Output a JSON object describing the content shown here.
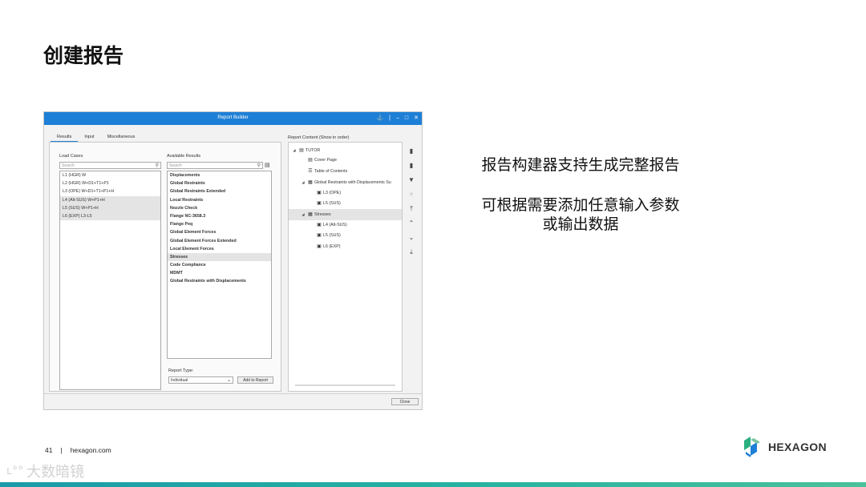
{
  "slide": {
    "title": "创建报告",
    "description_line1": "报告构建器支持生成完整报告",
    "description_line2": "可根据需要添加任意输入参数",
    "description_line3": "或输出数据",
    "page_number": "41",
    "separator": "|",
    "website": "hexagon.com",
    "logo_text": "HEXAGON",
    "watermark": "大数暗镜"
  },
  "window": {
    "title": "Report Builder",
    "controls": [
      "⚓",
      "|",
      "–",
      "□",
      "✕"
    ],
    "tabs": [
      "Results",
      "Input",
      "Miscellaneous"
    ],
    "active_tab": "Results",
    "load_cases_label": "Load Cases",
    "load_search_placeholder": "Search",
    "load_cases": [
      {
        "label": "L1 (HGR) W",
        "selected": false
      },
      {
        "label": "L2 (HGR) W+D1+T1+P1",
        "selected": false
      },
      {
        "label": "L3 (OPE) W+D1+T1+P1+H",
        "selected": false
      },
      {
        "label": "L4 (Alt-SUS) W+P1+H",
        "selected": true
      },
      {
        "label": "L5 (SUS) W+P1+H",
        "selected": true
      },
      {
        "label": "L6 (EXP) L3-L5",
        "selected": true
      }
    ],
    "available_label": "Available Results",
    "available_search_placeholder": "Search",
    "available_results": [
      {
        "label": "Displacements",
        "selected": false
      },
      {
        "label": "Global Restraints",
        "selected": false
      },
      {
        "label": "Global Restraints Extended",
        "selected": false
      },
      {
        "label": "Local Restraints",
        "selected": false
      },
      {
        "label": "Nozzle Check",
        "selected": false
      },
      {
        "label": "Flange NC-3658.3",
        "selected": false
      },
      {
        "label": "Flange Peq",
        "selected": false
      },
      {
        "label": "Global Element Forces",
        "selected": false
      },
      {
        "label": "Global Element Forces Extended",
        "selected": false
      },
      {
        "label": "Local Element Forces",
        "selected": false
      },
      {
        "label": "Stresses",
        "selected": true
      },
      {
        "label": "Code Compliance",
        "selected": false
      },
      {
        "label": "MDMT",
        "selected": false
      },
      {
        "label": "Global Restraints with Displacements",
        "selected": false
      }
    ],
    "report_type_label": "Report Type:",
    "report_type_value": "Individual",
    "add_to_report": "Add to Report",
    "report_content_label": "Report Content (Show in order)",
    "tree": [
      {
        "label": "TUTOR",
        "expander": "◢",
        "icon": "▤",
        "level": 0,
        "selected": false
      },
      {
        "label": "Cover Page",
        "expander": "",
        "icon": "▤",
        "level": 1,
        "selected": false
      },
      {
        "label": "Table of Contents",
        "expander": "",
        "icon": "☰",
        "level": 1,
        "selected": false
      },
      {
        "label": "Global Restraints with Displacements Su",
        "expander": "◢",
        "icon": "▦",
        "level": 1,
        "selected": false
      },
      {
        "label": "L3 (OPE)",
        "expander": "",
        "icon": "▣",
        "level": 2,
        "selected": false
      },
      {
        "label": "L5 (SUS)",
        "expander": "",
        "icon": "▣",
        "level": 2,
        "selected": false
      },
      {
        "label": "Stresses",
        "expander": "◢",
        "icon": "▦",
        "level": 1,
        "selected": true
      },
      {
        "label": "L4 (Alt-SUS)",
        "expander": "",
        "icon": "▣",
        "level": 2,
        "selected": false
      },
      {
        "label": "L5 (SUS)",
        "expander": "",
        "icon": "▣",
        "level": 2,
        "selected": false
      },
      {
        "label": "L6 (EXP)",
        "expander": "",
        "icon": "▣",
        "level": 2,
        "selected": false
      }
    ],
    "close_button": "Close"
  },
  "colors": {
    "titlebar": "#1e7fd6",
    "bottom_bar": "#1b9aa9",
    "logo_green": "#2bb07f",
    "logo_blue": "#1e7fd6"
  }
}
